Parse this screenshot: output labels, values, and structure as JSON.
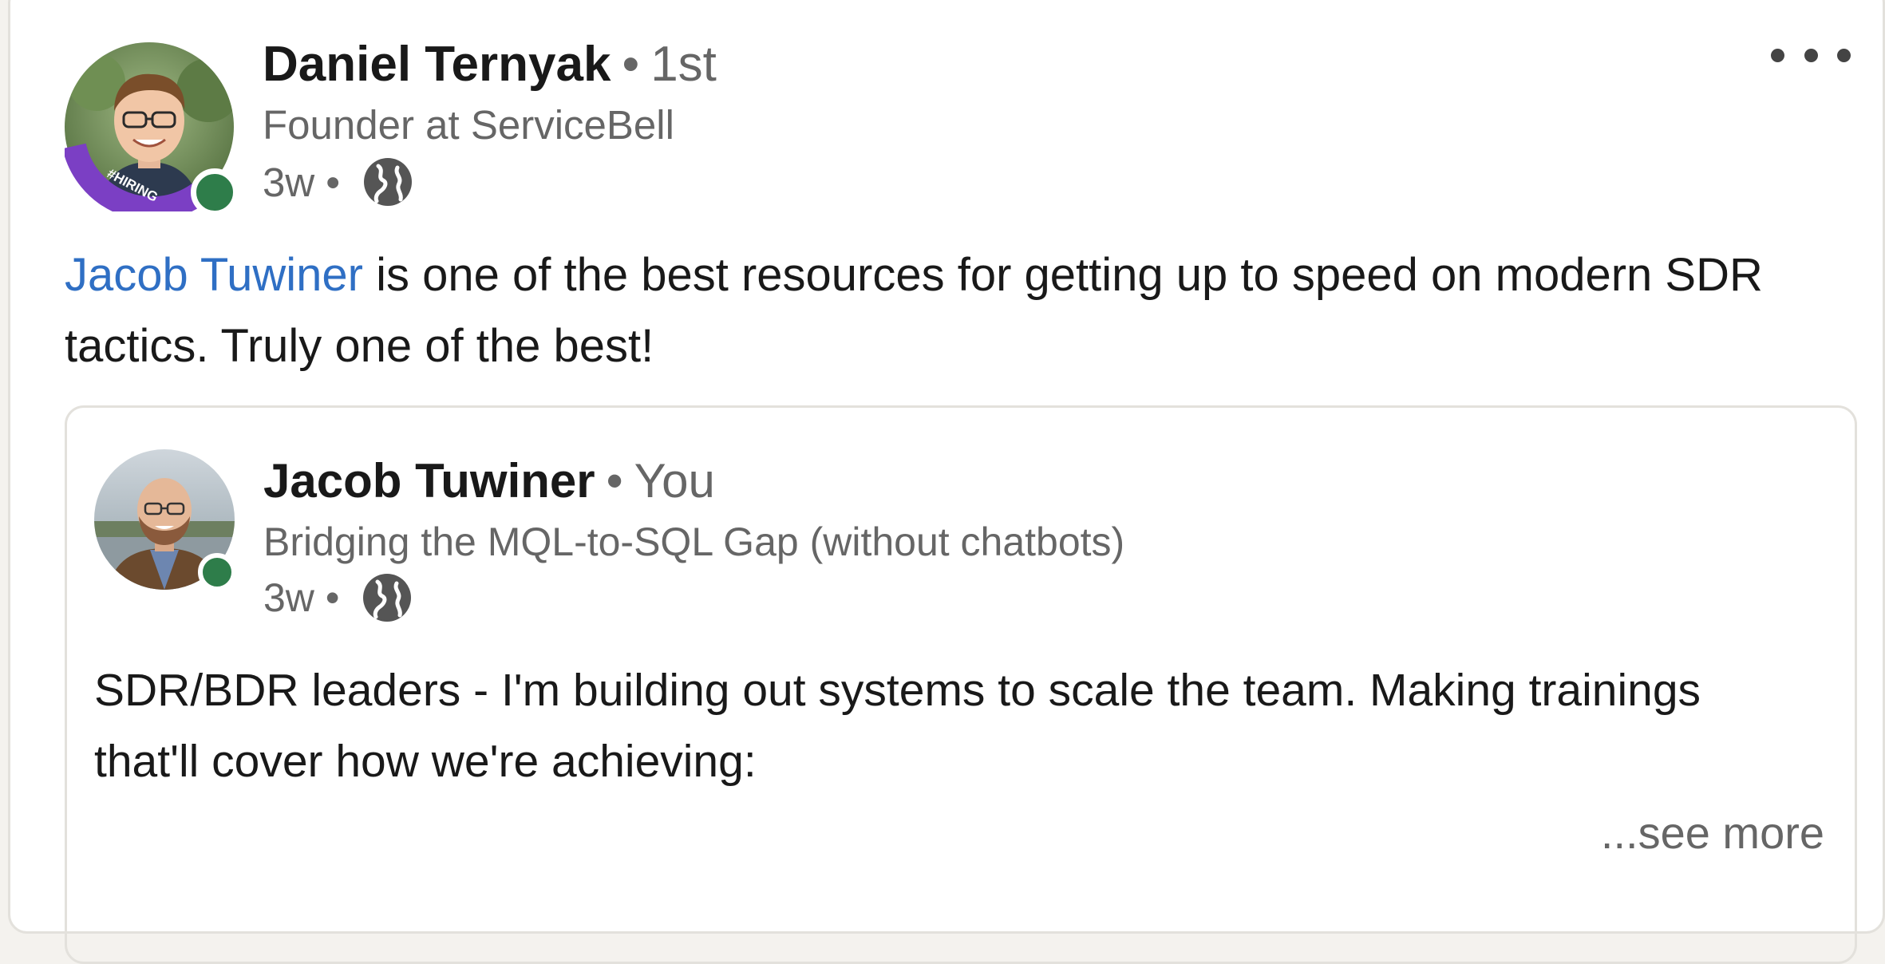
{
  "post": {
    "author": {
      "name": "Daniel Ternyak",
      "separator": "•",
      "degree": "1st",
      "headline": "Founder at ServiceBell",
      "badge_text": "#HIRING",
      "time": "3w",
      "meta_separator": "•",
      "visibility_icon": "globe-icon"
    },
    "text": {
      "mention": "Jacob Tuwiner",
      "rest": " is one of the best resources for getting up to speed on modern SDR tactics. Truly one of the best!"
    },
    "menu_icon": "more-horizontal-icon"
  },
  "shared_post": {
    "author": {
      "name": "Jacob Tuwiner",
      "separator": "•",
      "relation": "You",
      "headline": "Bridging the MQL-to-SQL Gap (without chatbots)",
      "time": "3w",
      "meta_separator": "•",
      "visibility_icon": "globe-icon"
    },
    "text": "SDR/BDR leaders - I'm building out systems to scale the team. Making trainings that'll cover how we're achieving:",
    "see_more": "...see more"
  },
  "colors": {
    "mention": "#2f6fc4",
    "presence": "#2e7d4a",
    "hiring_ring": "#7b3fc4"
  }
}
